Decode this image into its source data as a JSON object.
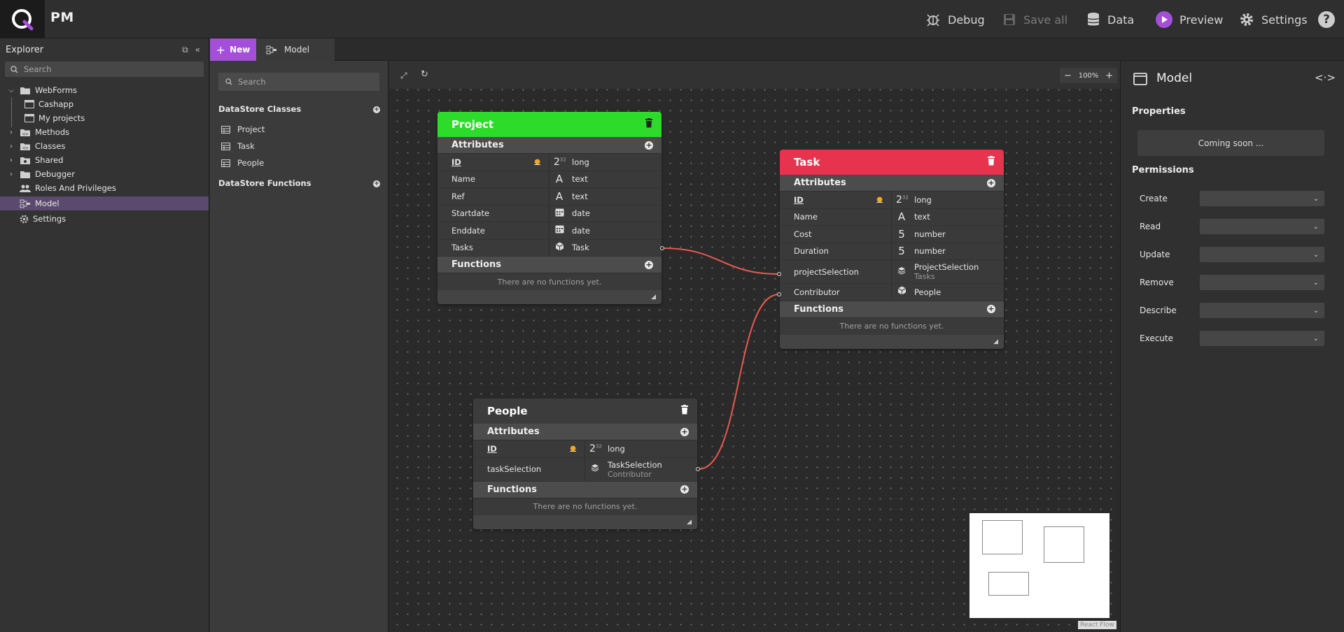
{
  "header": {
    "app_title": "PM",
    "buttons": {
      "debug": "Debug",
      "save_all": "Save all",
      "data": "Data",
      "preview": "Preview",
      "settings": "Settings"
    },
    "help": "?"
  },
  "explorer": {
    "title": "Explorer",
    "search_placeholder": "Search",
    "items": [
      {
        "label": "WebForms"
      },
      {
        "label": "Cashapp"
      },
      {
        "label": "My projects"
      },
      {
        "label": "Methods"
      },
      {
        "label": "Classes"
      },
      {
        "label": "Shared"
      },
      {
        "label": "Debugger"
      },
      {
        "label": "Roles And Privileges"
      },
      {
        "label": "Model"
      },
      {
        "label": "Settings"
      }
    ]
  },
  "tabs": {
    "new_label": "New",
    "model_tab": "Model"
  },
  "classpanel": {
    "search_placeholder": "Search",
    "classes_title": "DataStore Classes",
    "classes": [
      "Project",
      "Task",
      "People"
    ],
    "functions_title": "DataStore Functions"
  },
  "canvas": {
    "zoom": "100%",
    "attribution": "React Flow"
  },
  "nodes": {
    "project": {
      "title": "Project",
      "color": "#2ddc2a",
      "attributes_title": "Attributes",
      "functions_title": "Functions",
      "no_functions": "There are no functions yet.",
      "attrs": [
        {
          "name": "ID",
          "type": "long",
          "icon": "2"
        },
        {
          "name": "Name",
          "type": "text",
          "icon": "A"
        },
        {
          "name": "Ref",
          "type": "text",
          "icon": "A"
        },
        {
          "name": "Startdate",
          "type": "date",
          "icon": "calendar"
        },
        {
          "name": "Enddate",
          "type": "date",
          "icon": "calendar"
        },
        {
          "name": "Tasks",
          "type": "Task",
          "icon": "cube"
        }
      ]
    },
    "task": {
      "title": "Task",
      "color": "#e8334f",
      "attributes_title": "Attributes",
      "functions_title": "Functions",
      "no_functions": "There are no functions yet.",
      "attrs": [
        {
          "name": "ID",
          "type": "long",
          "icon": "2"
        },
        {
          "name": "Name",
          "type": "text",
          "icon": "A"
        },
        {
          "name": "Cost",
          "type": "number",
          "icon": "5"
        },
        {
          "name": "Duration",
          "type": "number",
          "icon": "5"
        },
        {
          "name": "projectSelection",
          "type": "ProjectSelection",
          "sub": "Tasks",
          "icon": "layers"
        },
        {
          "name": "Contributor",
          "type": "People",
          "icon": "cube"
        }
      ]
    },
    "people": {
      "title": "People",
      "color": "#3c3c3c",
      "attributes_title": "Attributes",
      "functions_title": "Functions",
      "no_functions": "There are no functions yet.",
      "attrs": [
        {
          "name": "ID",
          "type": "long",
          "icon": "2"
        },
        {
          "name": "taskSelection",
          "type": "TaskSelection",
          "sub": "Contributor",
          "icon": "layers"
        }
      ]
    }
  },
  "right_panel": {
    "title": "Model",
    "properties_title": "Properties",
    "coming_soon": "Coming soon ...",
    "permissions_title": "Permissions",
    "permissions": [
      "Create",
      "Read",
      "Update",
      "Remove",
      "Describe",
      "Execute"
    ]
  },
  "colors": {
    "accent": "#a34fd9",
    "edge": "#e8584f",
    "selected_row": "#5b4a6d"
  }
}
